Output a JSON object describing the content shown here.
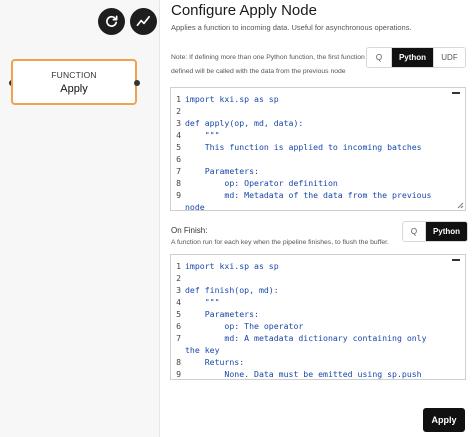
{
  "canvas": {
    "node": {
      "type": "FUNCTION",
      "name": "Apply",
      "border_color": "#f0a24e"
    },
    "buttons": [
      {
        "icon": "refresh-icon"
      },
      {
        "icon": "activity-icon"
      }
    ]
  },
  "panel": {
    "title": "Configure Apply Node",
    "subtitle": "Applies a function to incoming data. Useful for asynchronous operations.",
    "note": "Note: If defining more than one Python function, the first function defined will be called with the data from the previous node",
    "language_options": [
      "Q",
      "Python",
      "UDF"
    ],
    "language_selected": "Python",
    "apply_code": [
      {
        "n": "1",
        "text": "import kxi.sp as sp"
      },
      {
        "n": "2",
        "text": ""
      },
      {
        "n": "3",
        "text": "def apply(op, md, data):"
      },
      {
        "n": "4",
        "text": "    \"\"\""
      },
      {
        "n": "5",
        "text": "    This function is applied to incoming batches"
      },
      {
        "n": "6",
        "text": ""
      },
      {
        "n": "7",
        "text": "    Parameters:"
      },
      {
        "n": "8",
        "text": "        op: Operator definition"
      },
      {
        "n": "9",
        "text": "        md: Metadata of the data from the previous"
      },
      {
        "n": "",
        "text": "node"
      }
    ],
    "on_finish": {
      "label": "On Finish:",
      "description": "A function run for each key when the pipeline finishes, to flush the buffer.",
      "language_options": [
        "Q",
        "Python"
      ],
      "language_selected": "Python",
      "code": [
        {
          "n": "1",
          "text": "import kxi.sp as sp"
        },
        {
          "n": "2",
          "text": ""
        },
        {
          "n": "3",
          "text": "def finish(op, md):"
        },
        {
          "n": "4",
          "text": "    \"\"\""
        },
        {
          "n": "5",
          "text": "    Parameters:"
        },
        {
          "n": "6",
          "text": "        op: The operator"
        },
        {
          "n": "7",
          "text": "        md: A metadata dictionary containing only"
        },
        {
          "n": "",
          "text": "the key"
        },
        {
          "n": "8",
          "text": "    Returns:"
        },
        {
          "n": "9",
          "text": "        None. Data must be emitted using sp.push"
        }
      ]
    },
    "apply_button": "Apply"
  }
}
